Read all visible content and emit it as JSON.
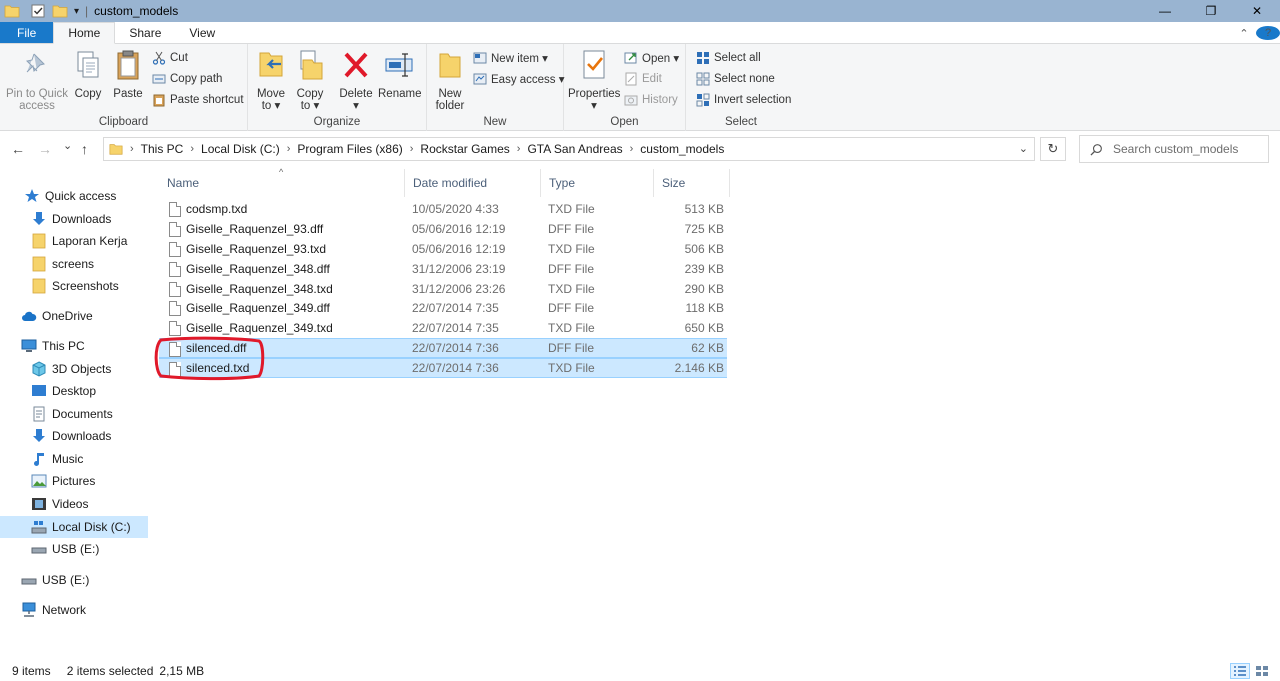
{
  "window": {
    "title": "custom_models",
    "controls": {
      "minimize": "—",
      "maximize": "❐",
      "close": "✕"
    }
  },
  "ribbon_tabs": {
    "file": "File",
    "home": "Home",
    "share": "Share",
    "view": "View",
    "collapse": "⌃",
    "help": "?"
  },
  "ribbon": {
    "clipboard": {
      "label": "Clipboard",
      "pin_line1": "Pin to Quick",
      "pin_line2": "access",
      "copy": "Copy",
      "paste": "Paste",
      "cut": "Cut",
      "copy_path": "Copy path",
      "paste_shortcut": "Paste shortcut"
    },
    "organize": {
      "label": "Organize",
      "move_line1": "Move",
      "move_line2": "to ▾",
      "copy_line1": "Copy",
      "copy_line2": "to ▾",
      "delete_line1": "Delete",
      "delete_line2": "▾",
      "rename": "Rename"
    },
    "new": {
      "label": "New",
      "new_folder_line1": "New",
      "new_folder_line2": "folder",
      "new_item": "New item ▾",
      "easy_access": "Easy access ▾"
    },
    "open": {
      "label": "Open",
      "properties_line1": "Properties",
      "properties_line2": "▾",
      "open": "Open ▾",
      "edit": "Edit",
      "history": "History"
    },
    "select": {
      "label": "Select",
      "select_all": "Select all",
      "select_none": "Select none",
      "invert": "Invert selection"
    }
  },
  "nav": {
    "back": "←",
    "forward": "→",
    "recent": "⌄",
    "up": "↑",
    "breadcrumbs": [
      "This PC",
      "Local Disk (C:)",
      "Program Files (x86)",
      "Rockstar Games",
      "GTA San Andreas",
      "custom_models"
    ],
    "sep": "›",
    "address_dropdown": "⌄",
    "refresh": "↻",
    "search_placeholder": "Search custom_models"
  },
  "sidebar": {
    "quick_access": "Quick access",
    "qa_items": [
      "Downloads",
      "Laporan Kerja",
      "screens",
      "Screenshots"
    ],
    "onedrive": "OneDrive",
    "this_pc": "This PC",
    "pc_items": [
      "3D Objects",
      "Desktop",
      "Documents",
      "Downloads",
      "Music",
      "Pictures",
      "Videos",
      "Local Disk (C:)",
      "USB (E:)"
    ],
    "usb": "USB (E:)",
    "network": "Network"
  },
  "columns": {
    "name": "Name",
    "date": "Date modified",
    "type": "Type",
    "size": "Size",
    "sort": "^"
  },
  "files": [
    {
      "name": "codsmp.txd",
      "date": "10/05/2020 4:33",
      "type": "TXD File",
      "size": "513 KB"
    },
    {
      "name": "Giselle_Raquenzel_93.dff",
      "date": "05/06/2016 12:19",
      "type": "DFF File",
      "size": "725 KB"
    },
    {
      "name": "Giselle_Raquenzel_93.txd",
      "date": "05/06/2016 12:19",
      "type": "TXD File",
      "size": "506 KB"
    },
    {
      "name": "Giselle_Raquenzel_348.dff",
      "date": "31/12/2006 23:19",
      "type": "DFF File",
      "size": "239 KB"
    },
    {
      "name": "Giselle_Raquenzel_348.txd",
      "date": "31/12/2006 23:26",
      "type": "TXD File",
      "size": "290 KB"
    },
    {
      "name": "Giselle_Raquenzel_349.dff",
      "date": "22/07/2014 7:35",
      "type": "DFF File",
      "size": "118 KB"
    },
    {
      "name": "Giselle_Raquenzel_349.txd",
      "date": "22/07/2014 7:35",
      "type": "TXD File",
      "size": "650 KB"
    },
    {
      "name": "silenced.dff",
      "date": "22/07/2014 7:36",
      "type": "DFF File",
      "size": "62 KB"
    },
    {
      "name": "silenced.txd",
      "date": "22/07/2014 7:36",
      "type": "TXD File",
      "size": "2.146 KB"
    }
  ],
  "status": {
    "items": "9 items",
    "selected": "2 items selected",
    "size": "2,15 MB"
  },
  "colors": {
    "accent": "#1979ca",
    "selection": "#cce8ff",
    "annotation": "#e0192a",
    "titlebar": "#99b4d1"
  }
}
